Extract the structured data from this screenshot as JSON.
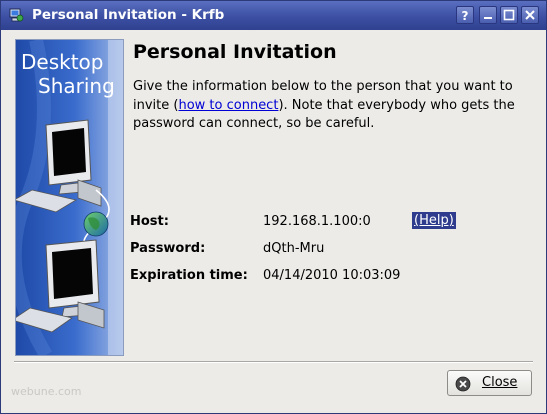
{
  "window": {
    "title": "Personal Invitation - Krfb",
    "buttons": [
      "help",
      "minimize",
      "maximize",
      "close"
    ]
  },
  "banner": {
    "line1": "Desktop",
    "line2": "Sharing"
  },
  "heading": "Personal Invitation",
  "description": {
    "before_link": "Give the information below to the person that you want to invite (",
    "link_text": "how to connect",
    "after_link": "). Note that everybody who gets the password can connect, so be careful."
  },
  "fields": {
    "host_label": "Host:",
    "host_value": "192.168.1.100:0",
    "help_link": "(Help)",
    "password_label": "Password:",
    "password_value": "dQth-Mru",
    "expiration_label": "Expiration time:",
    "expiration_value": "04/14/2010 10:03:09"
  },
  "watermark": "webune.com",
  "footer": {
    "close_label": "Close"
  },
  "colors": {
    "titlebar": "#3c4fa3",
    "banner_blue": "#2c55b8",
    "link": "#0000d4",
    "help_highlight": "#2f3c8e"
  }
}
